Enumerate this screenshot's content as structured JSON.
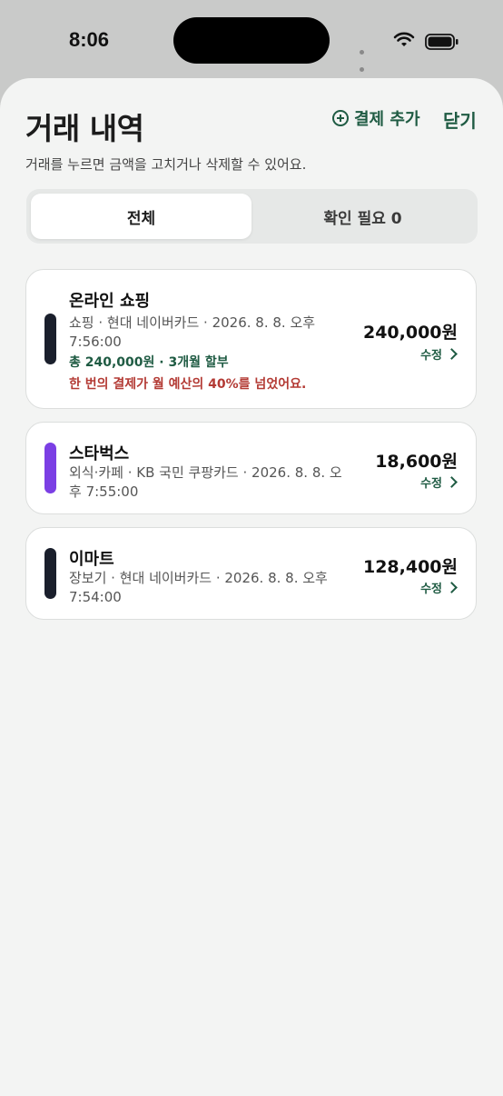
{
  "status_bar": {
    "time": "8:06"
  },
  "header": {
    "title": "거래 내역",
    "add_payment_label": "결제 추가",
    "close_label": "닫기",
    "subtitle": "거래를 누르면 금액을 고치거나 삭제할 수 있어요."
  },
  "tabs": [
    {
      "label": "전체",
      "active": true
    },
    {
      "label": "확인 필요 0",
      "active": false
    }
  ],
  "transactions": [
    {
      "name": "온라인 쇼핑",
      "meta": "쇼핑 · 현대 네이버카드 · 2026. 8. 8. 오후 7:56:00",
      "installment": "총 240,000원 · 3개월 할부",
      "warning": "한 번의 결제가 월 예산의 40%를 넘었어요.",
      "amount": "240,000원",
      "edit_label": "수정",
      "bar_color": "#1a1f2c"
    },
    {
      "name": "스타벅스",
      "meta": "외식·카페 · KB 국민 쿠팡카드 · 2026. 8. 8. 오후 7:55:00",
      "amount": "18,600원",
      "edit_label": "수정",
      "bar_color": "#7b3fe4"
    },
    {
      "name": "이마트",
      "meta": "장보기 · 현대 네이버카드 · 2026. 8. 8. 오후 7:54:00",
      "amount": "128,400원",
      "edit_label": "수정",
      "bar_color": "#1a1f2c"
    }
  ],
  "colors": {
    "accent": "#1f5b43",
    "warning": "#b33a34",
    "sheet_background": "#f3f4f3"
  }
}
